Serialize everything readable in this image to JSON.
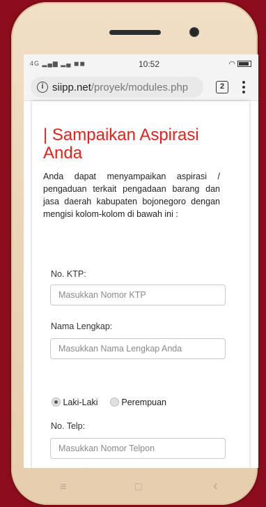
{
  "statusbar": {
    "signal": "4G",
    "time": "10:52"
  },
  "browser": {
    "url_host": "siipp.net",
    "url_path": "/proyek/modules.php",
    "tab_count": "2"
  },
  "page": {
    "title": "| Sampaikan Aspirasi Anda",
    "intro": "Anda dapat menyampaikan aspirasi / pengaduan terkait pengadaan barang dan jasa daerah kabupaten bojonegoro dengan mengisi kolom-kolom di bawah ini :",
    "ktp_label": "No. KTP:",
    "ktp_placeholder": "Masukkan Nomor KTP",
    "name_label": "Nama Lengkap:",
    "name_placeholder": "Masukkan Nama Lengkap Anda",
    "gender_male": "Laki-Laki",
    "gender_female": "Perempuan",
    "gender_selected": "Laki-Laki",
    "phone_label": "No. Telp:",
    "phone_placeholder": "Masukkan Nomor Telpon"
  },
  "navbar": {
    "menu_icon": "≡",
    "home_icon": "□",
    "back_icon": "‹"
  },
  "colors": {
    "background": "#8e0d1c",
    "title": "#e8201a",
    "phone_body": "#ead4b6"
  }
}
